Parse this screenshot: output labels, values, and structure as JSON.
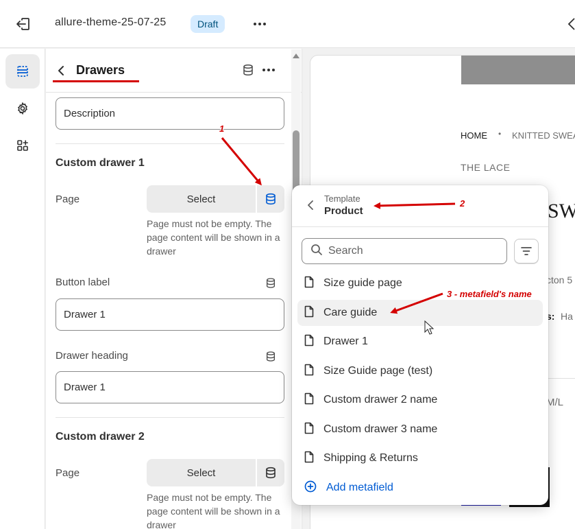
{
  "topbar": {
    "theme_name": "allure-theme-25-07-25",
    "status_badge": "Draft"
  },
  "panel": {
    "title": "Drawers",
    "description_value": "Description",
    "drawer1": {
      "heading": "Custom drawer 1",
      "page_label": "Page",
      "select_label": "Select",
      "help": "Page must not be empty. The page content will be shown in a drawer",
      "button_label_label": "Button label",
      "button_label_value": "Drawer 1",
      "drawer_heading_label": "Drawer heading",
      "drawer_heading_value": "Drawer 1"
    },
    "drawer2": {
      "heading": "Custom drawer 2",
      "page_label": "Page",
      "select_label": "Select",
      "help": "Page must not be empty. The page content will be shown in a drawer"
    }
  },
  "preview": {
    "breadcrumb_home": "HOME",
    "breadcrumb_sep": "•",
    "breadcrumb_item": "KNITTED SWEA",
    "vendor": "THE LACE",
    "title_fragment": "SW",
    "frag_cotton": "cton 5",
    "frag_label": "s:",
    "frag_value": "Ha",
    "frag_size": "M/L"
  },
  "popover": {
    "caption": "Template",
    "title": "Product",
    "search_placeholder": "Search",
    "items": [
      {
        "label": "Size guide page"
      },
      {
        "label": "Care guide"
      },
      {
        "label": "Drawer 1"
      },
      {
        "label": "Size Guide page (test)"
      },
      {
        "label": "Custom drawer 2 name"
      },
      {
        "label": "Custom drawer 3 name"
      },
      {
        "label": "Shipping & Returns"
      }
    ],
    "add_label": "Add metafield"
  },
  "annotations": {
    "a1": "1",
    "a2": "2",
    "a3": "3 - metafield's name"
  },
  "colors": {
    "accent_blue": "#005bd3",
    "annotation_red": "#d40000",
    "badge_bg": "#d5ebff"
  }
}
